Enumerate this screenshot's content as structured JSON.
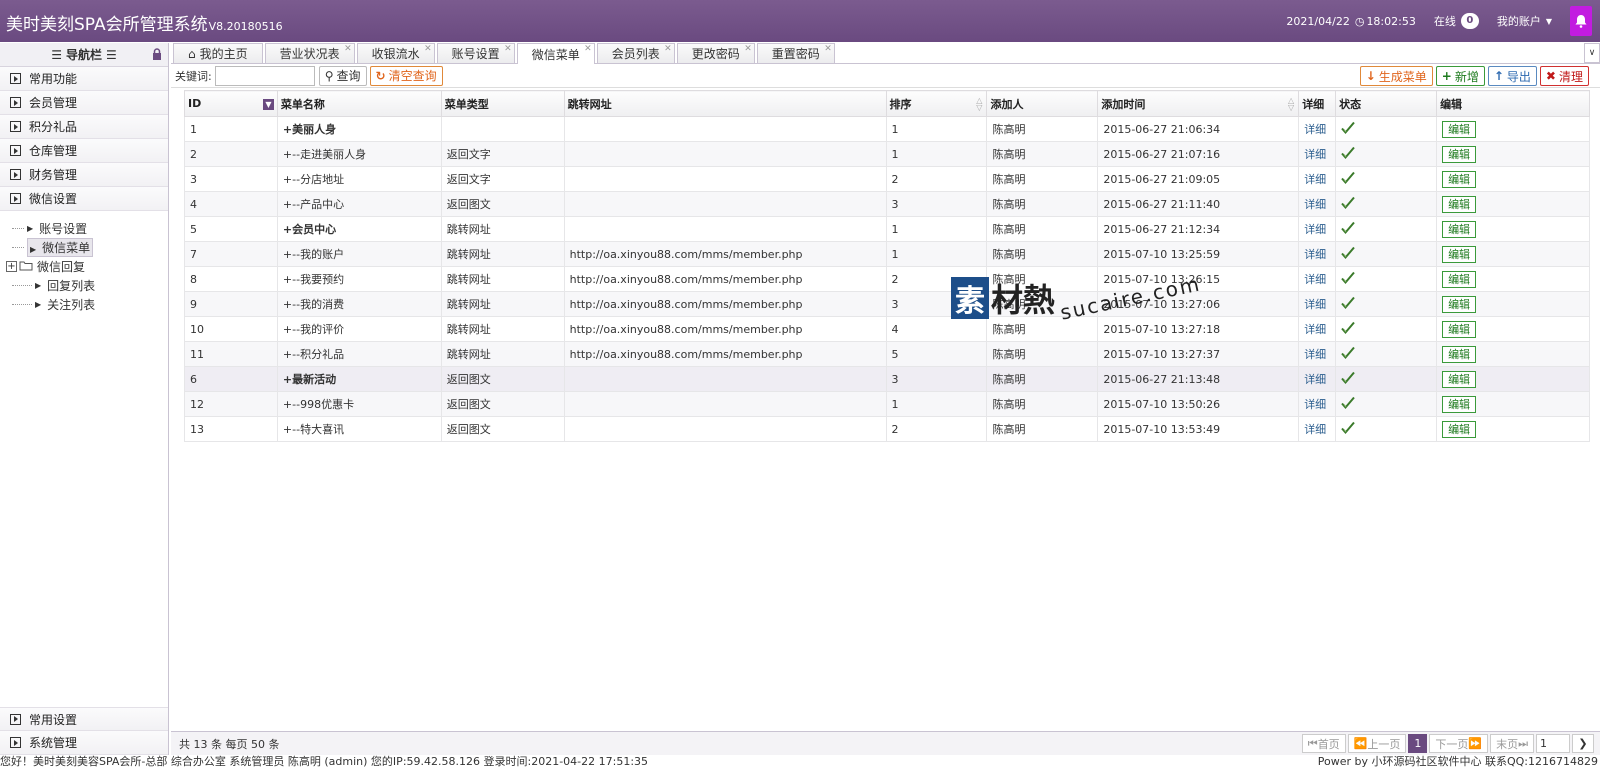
{
  "header": {
    "title": "美时美刻SPA会所管理系统",
    "version": "V8.20180516",
    "datetime": "2021/04/22",
    "time": "18:02:53",
    "online_label": "在线",
    "online_count": "0",
    "account_label": "我的账户"
  },
  "sidebar": {
    "title": "导航栏",
    "groups": [
      {
        "label": "常用功能"
      },
      {
        "label": "会员管理"
      },
      {
        "label": "积分礼品"
      },
      {
        "label": "仓库管理"
      },
      {
        "label": "财务管理"
      },
      {
        "label": "微信设置"
      }
    ],
    "tree": [
      {
        "label": "账号设置"
      },
      {
        "label": "微信菜单"
      },
      {
        "label": "微信回复"
      },
      {
        "label": "回复列表"
      },
      {
        "label": "关注列表"
      }
    ],
    "bottom_groups": [
      {
        "label": "常用设置"
      },
      {
        "label": "系统管理"
      }
    ]
  },
  "tabs": [
    {
      "label": "我的主页"
    },
    {
      "label": "营业状况表"
    },
    {
      "label": "收银流水"
    },
    {
      "label": "账号设置"
    },
    {
      "label": "微信菜单"
    },
    {
      "label": "会员列表"
    },
    {
      "label": "更改密码"
    },
    {
      "label": "重置密码"
    }
  ],
  "toolbar": {
    "keyword_label": "关键词:",
    "search_label": "查询",
    "clear_label": "清空查询",
    "generate_label": "生成菜单",
    "add_label": "新增",
    "export_label": "导出",
    "purge_label": "清理"
  },
  "table": {
    "columns": [
      "ID",
      "菜单名称",
      "菜单类型",
      "跳转网址",
      "排序",
      "添加人",
      "添加时间",
      "详细",
      "状态",
      "编辑"
    ],
    "detail_label": "详细",
    "edit_label": "编辑",
    "rows": [
      {
        "id": "1",
        "name": "+美丽人身",
        "type": "",
        "url": "",
        "order": "1",
        "by": "陈高明",
        "time": "2015-06-27 21:06:34"
      },
      {
        "id": "2",
        "name": "+--走进美丽人身",
        "type": "返回文字",
        "url": "",
        "order": "1",
        "by": "陈高明",
        "time": "2015-06-27 21:07:16"
      },
      {
        "id": "3",
        "name": "+--分店地址",
        "type": "返回文字",
        "url": "",
        "order": "2",
        "by": "陈高明",
        "time": "2015-06-27 21:09:05"
      },
      {
        "id": "4",
        "name": "+--产品中心",
        "type": "返回图文",
        "url": "",
        "order": "3",
        "by": "陈高明",
        "time": "2015-06-27 21:11:40"
      },
      {
        "id": "5",
        "name": "+会员中心",
        "type": "跳转网址",
        "url": "",
        "order": "1",
        "by": "陈高明",
        "time": "2015-06-27 21:12:34"
      },
      {
        "id": "7",
        "name": "+--我的账户",
        "type": "跳转网址",
        "url": "http://oa.xinyou88.com/mms/member.php",
        "order": "1",
        "by": "陈高明",
        "time": "2015-07-10 13:25:59"
      },
      {
        "id": "8",
        "name": "+--我要预约",
        "type": "跳转网址",
        "url": "http://oa.xinyou88.com/mms/member.php",
        "order": "2",
        "by": "陈高明",
        "time": "2015-07-10 13:26:15"
      },
      {
        "id": "9",
        "name": "+--我的消费",
        "type": "跳转网址",
        "url": "http://oa.xinyou88.com/mms/member.php",
        "order": "3",
        "by": "陈高明",
        "time": "2015-07-10 13:27:06"
      },
      {
        "id": "10",
        "name": "+--我的评价",
        "type": "跳转网址",
        "url": "http://oa.xinyou88.com/mms/member.php",
        "order": "4",
        "by": "陈高明",
        "time": "2015-07-10 13:27:18"
      },
      {
        "id": "11",
        "name": "+--积分礼品",
        "type": "跳转网址",
        "url": "http://oa.xinyou88.com/mms/member.php",
        "order": "5",
        "by": "陈高明",
        "time": "2015-07-10 13:27:37"
      },
      {
        "id": "6",
        "name": "+最新活动",
        "type": "返回图文",
        "url": "",
        "order": "3",
        "by": "陈高明",
        "time": "2015-06-27 21:13:48"
      },
      {
        "id": "12",
        "name": "+--998优惠卡",
        "type": "返回图文",
        "url": "",
        "order": "1",
        "by": "陈高明",
        "time": "2015-07-10 13:50:26"
      },
      {
        "id": "13",
        "name": "+--特大喜讯",
        "type": "返回图文",
        "url": "",
        "order": "2",
        "by": "陈高明",
        "time": "2015-07-10 13:53:49"
      }
    ]
  },
  "pager": {
    "summary": "共 13 条 每页 50 条",
    "first": "首页",
    "prev": "上一页",
    "current": "1",
    "next": "下一页",
    "last": "末页",
    "page_input": "1"
  },
  "statusbar": {
    "left": "您好！美时美刻美容SPA会所-总部 综合办公室 系统管理员 陈高明 (admin) 您的IP:59.42.58.126 登录时间:2021-04-22 17:51:35",
    "right": "Power by 小环源码社区软件中心 联系QQ:1216714829"
  },
  "watermark": {
    "badge": "素",
    "text": "材熱",
    "url": "sucaire.com"
  },
  "colors": {
    "brand": "#6a4a80",
    "bell": "#c21ce0",
    "edit_green": "#1d7a1d"
  }
}
